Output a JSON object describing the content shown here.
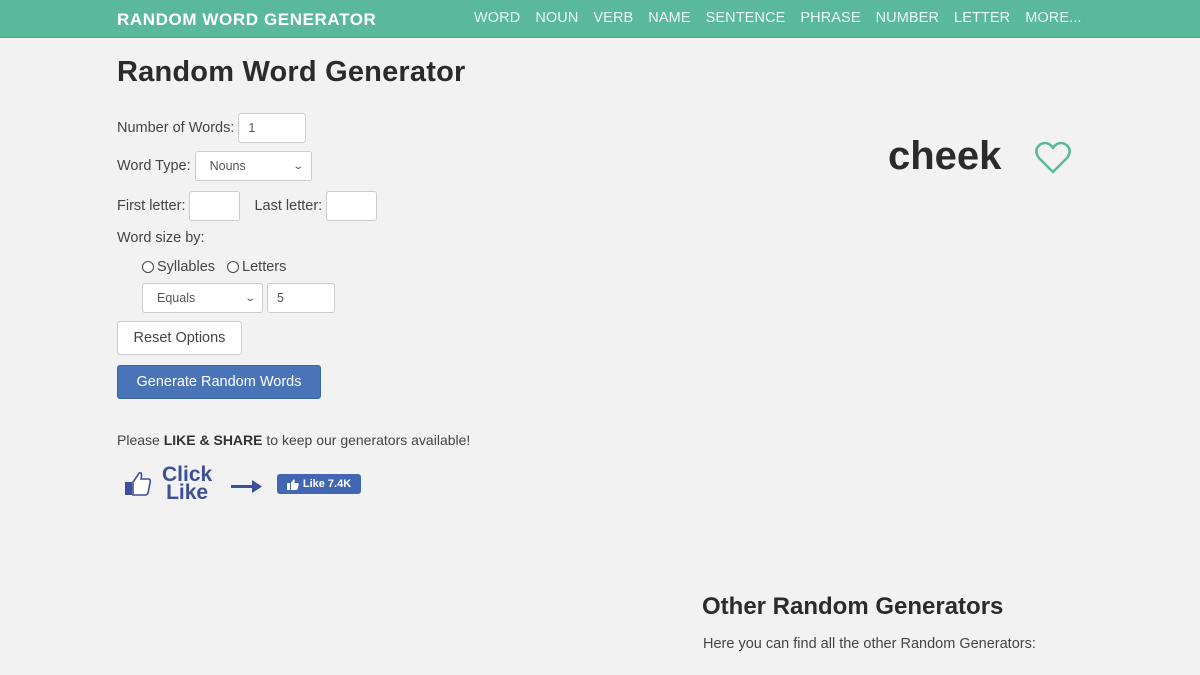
{
  "navbar": {
    "brand": "RANDOM WORD GENERATOR",
    "links": [
      "WORD",
      "NOUN",
      "VERB",
      "NAME",
      "SENTENCE",
      "PHRASE",
      "NUMBER",
      "LETTER",
      "MORE..."
    ],
    "background_color": "#5bb99b"
  },
  "page_title": "Random Word Generator",
  "form": {
    "number_of_words_label": "Number of Words:",
    "number_of_words_value": "1",
    "word_type_label": "Word Type:",
    "word_type_value": "Nouns",
    "first_letter_label": "First letter:",
    "first_letter_value": "",
    "last_letter_label": "Last letter:",
    "last_letter_value": "",
    "word_size_label": "Word size by:",
    "size_options": [
      "Syllables",
      "Letters"
    ],
    "comparison_value": "Equals",
    "size_value": "5",
    "reset_label": "Reset Options",
    "generate_label": "Generate Random Words"
  },
  "share": {
    "prefix": "Please ",
    "bold": "LIKE & SHARE",
    "suffix": " to keep our generators available!",
    "click_like_line1": "Click",
    "click_like_line2": "Like",
    "fb_like_label": "Like 7.4K"
  },
  "result": {
    "word": "cheek",
    "favorite_icon": "heart-outline-icon",
    "accent_color": "#5bb99b"
  },
  "other_generators": {
    "title": "Other Random Generators",
    "description": "Here you can find all the other Random Generators:"
  }
}
